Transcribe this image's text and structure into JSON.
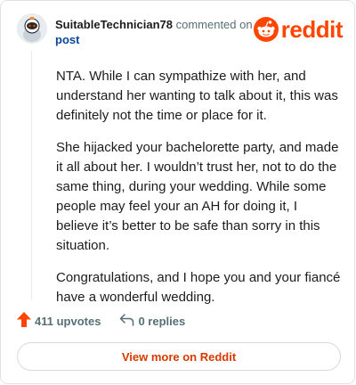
{
  "colors": {
    "brand": "#ff4500",
    "link_blue": "#0a449b",
    "muted": "#576f76",
    "view_more": "#d93900"
  },
  "header": {
    "username": "SuitableTechnician78",
    "action_text": "commented on",
    "post_link": "post",
    "logo_text": "reddit",
    "avatar_icon": "user-avatar-icon",
    "logo_icon": "reddit-snoo-icon"
  },
  "comment": {
    "paragraphs": [
      "NTA. While I can sympathize with her, and understand her wanting to talk about it, this was definitely not the time or place for it.",
      "She hijacked your bachelorette party, and made it all about her. I wouldn’t trust her, not to do the same thing, during your wedding. While some people may feel your an AH for doing it, I believe it’s better to be safe than sorry in this situation.",
      "Congratulations, and I hope you and your fiancé have a wonderful wedding."
    ]
  },
  "actions": {
    "upvotes": "411 upvotes",
    "replies": "0 replies",
    "upvote_icon": "upvote-arrow-icon",
    "reply_icon": "reply-arrow-icon"
  },
  "footer": {
    "view_more": "View more on Reddit"
  }
}
